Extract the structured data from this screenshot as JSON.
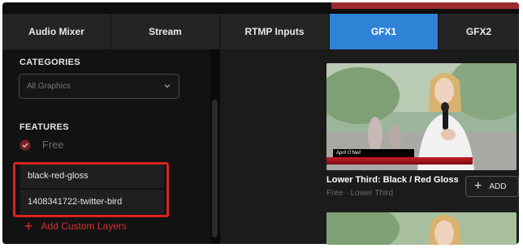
{
  "tabs": [
    {
      "label": "Audio Mixer"
    },
    {
      "label": "Stream"
    },
    {
      "label": "RTMP Inputs"
    },
    {
      "label": "GFX1",
      "active": true
    },
    {
      "label": "GFX2"
    }
  ],
  "sidebar": {
    "categories_title": "CATEGORIES",
    "category_select_value": "All Graphics",
    "features_title": "FEATURES",
    "feature_free_label": "Free",
    "custom_layers": [
      "black-red-gloss",
      "1408341722-twitter-bird"
    ],
    "add_custom_layers_label": "Add Custom Layers"
  },
  "graphics": [
    {
      "thumb_name": "April O'Neil",
      "title": "Lower Third: Black / Red Gloss",
      "subtitle": "Free · Lower Third",
      "add_label": "ADD"
    }
  ],
  "colors": {
    "accent": "#2f83d6",
    "highlight": "#d9241f",
    "add_custom": "#d9302c"
  },
  "icons": {
    "select": "chevron-down-icon",
    "free": "check-circle-icon",
    "add": "plus-icon"
  }
}
